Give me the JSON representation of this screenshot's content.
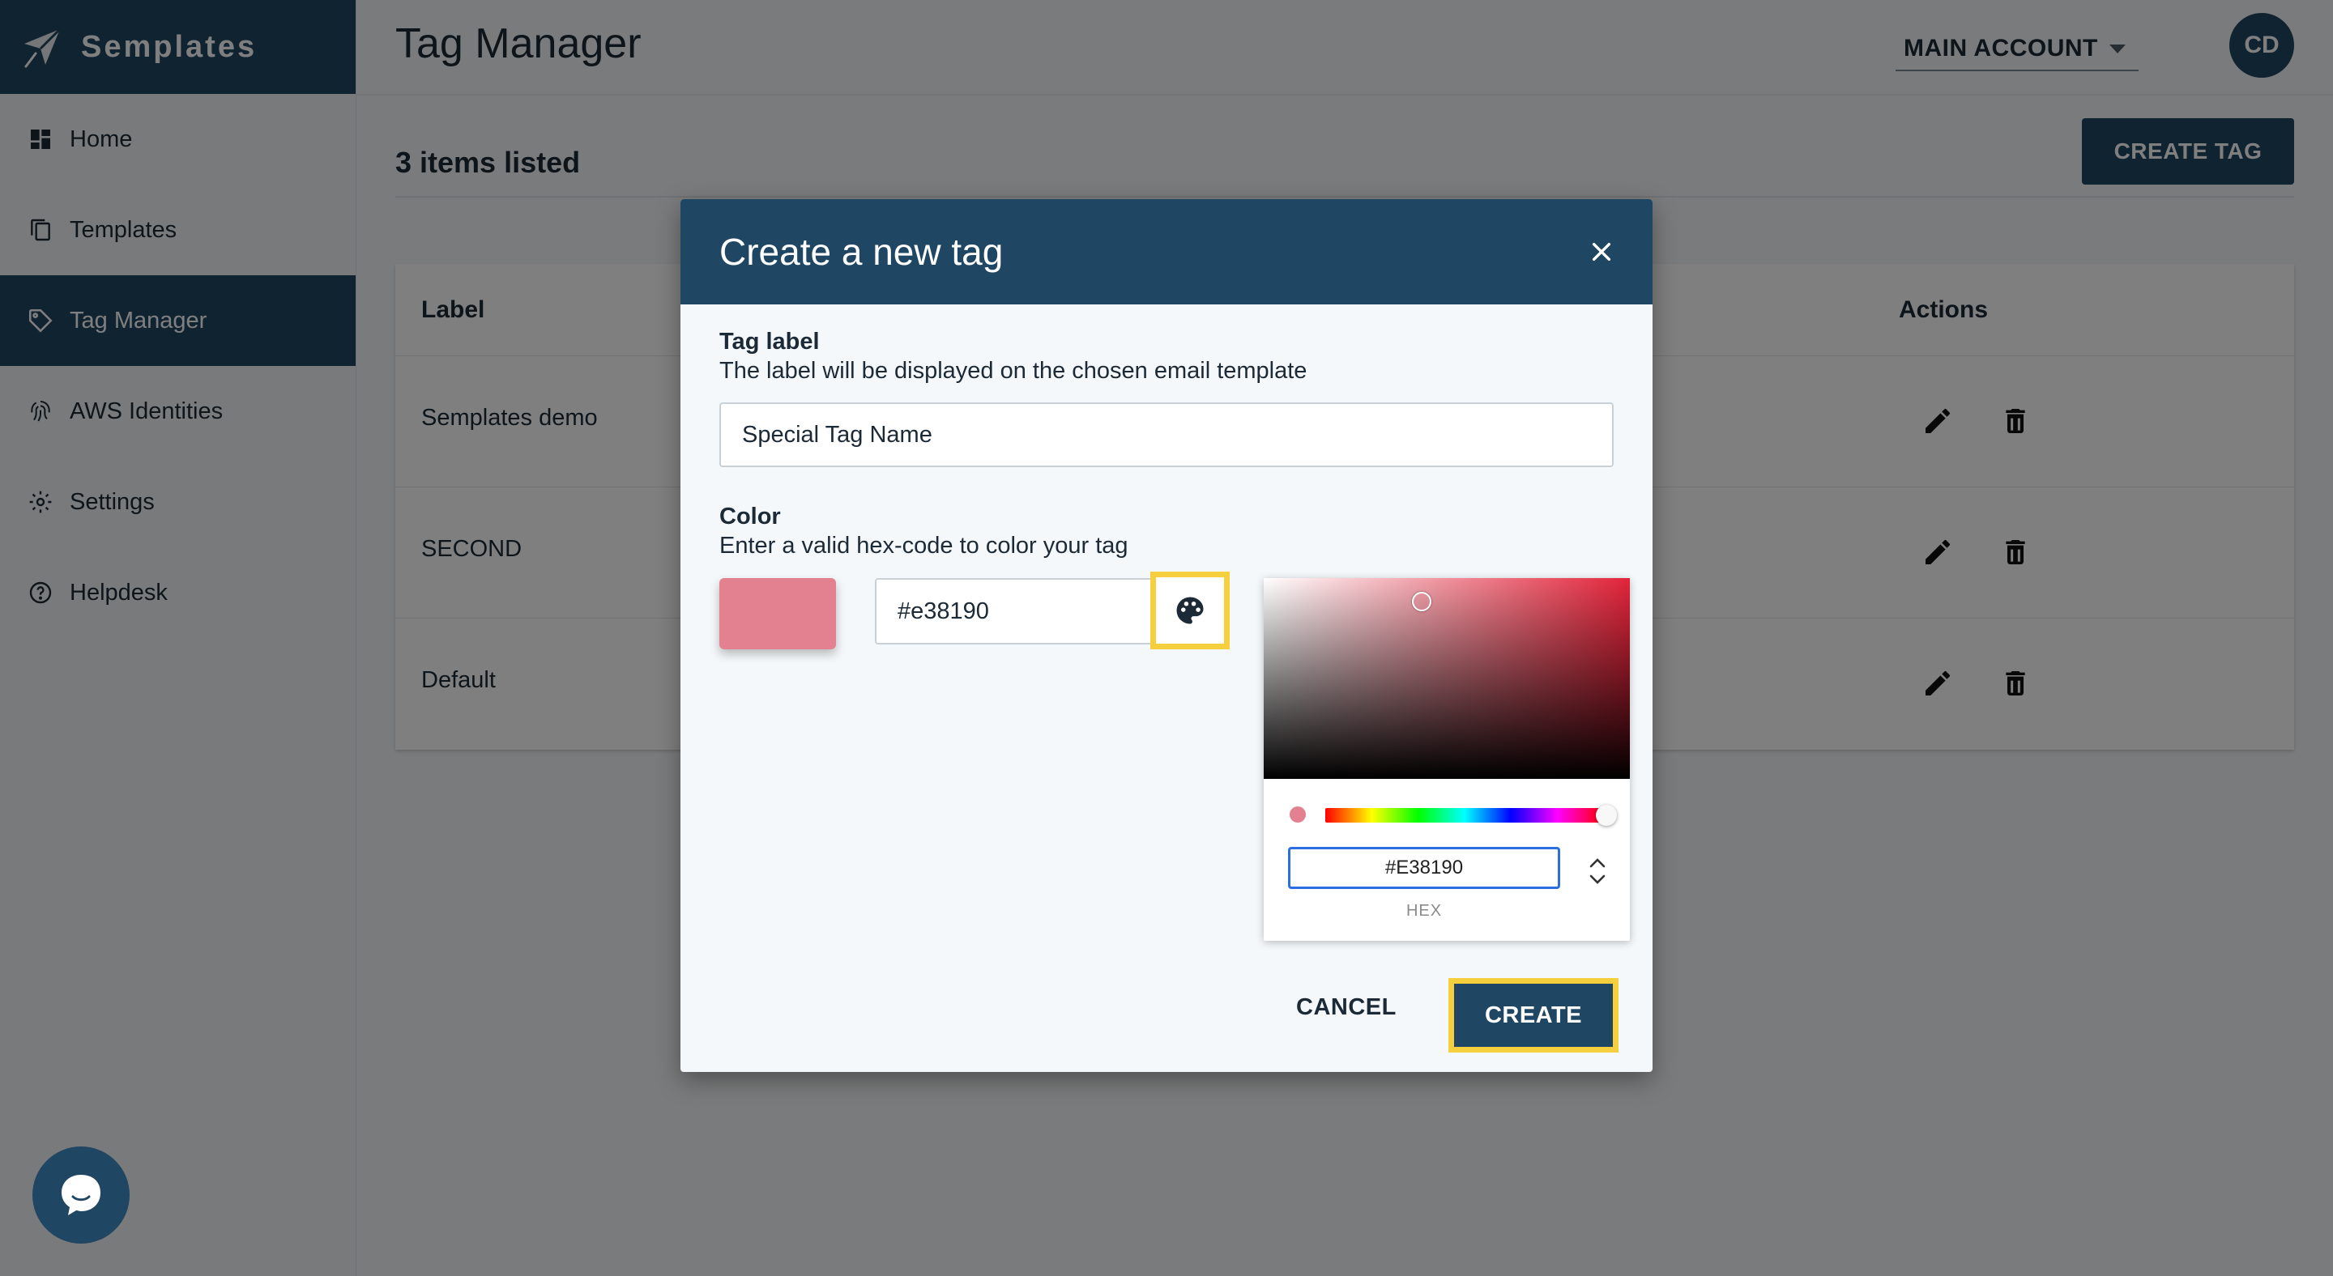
{
  "brand": {
    "name": "Semplates"
  },
  "sidebar": {
    "items": [
      {
        "label": "Home",
        "icon": "dashboard-icon"
      },
      {
        "label": "Templates",
        "icon": "copy-icon"
      },
      {
        "label": "Tag Manager",
        "icon": "tag-icon",
        "active": true
      },
      {
        "label": "AWS Identities",
        "icon": "fingerprint-icon"
      },
      {
        "label": "Settings",
        "icon": "gear-icon"
      },
      {
        "label": "Helpdesk",
        "icon": "help-circle-icon"
      }
    ]
  },
  "header": {
    "title": "Tag Manager",
    "account": "MAIN ACCOUNT",
    "avatar_initials": "CD"
  },
  "main": {
    "items_count": "3 items listed",
    "create_tag_label": "CREATE TAG",
    "table": {
      "columns": {
        "label": "Label",
        "actions": "Actions"
      },
      "rows": [
        {
          "label": "Semplates demo"
        },
        {
          "label": "SECOND"
        },
        {
          "label": "Default"
        }
      ]
    }
  },
  "dialog": {
    "title": "Create a new tag",
    "tag_label": {
      "title": "Tag label",
      "help": "The label will be displayed on the chosen email template",
      "value": "Special Tag Name"
    },
    "color": {
      "title": "Color",
      "help": "Enter a valid hex-code to color your tag",
      "value": "#e38190",
      "swatch": "#e38190"
    },
    "picker": {
      "hex_value": "#E38190",
      "hex_label": "HEX"
    },
    "cancel_label": "CANCEL",
    "create_label": "CREATE"
  },
  "colors": {
    "primary": "#1f4663",
    "highlight": "#f6cf3f",
    "focus": "#2d6fe0"
  }
}
